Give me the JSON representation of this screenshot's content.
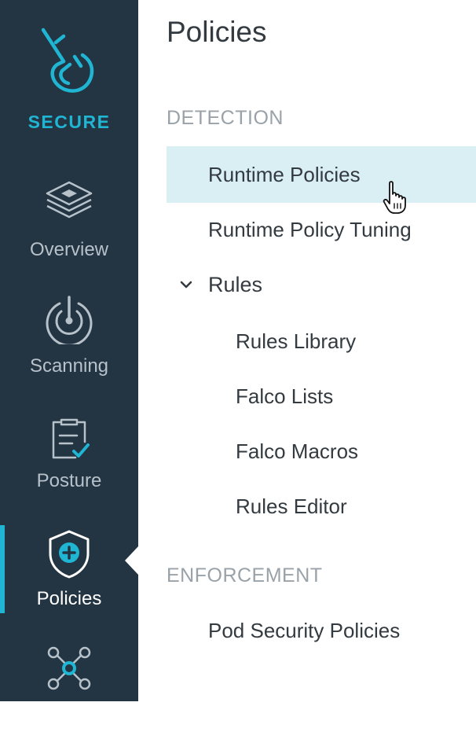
{
  "sidebar": {
    "brand": {
      "name": "SECURE",
      "icon": "secure-logo-icon",
      "color": "#1fb5d3"
    },
    "items": [
      {
        "label": "Overview",
        "icon": "layers-icon",
        "active": false
      },
      {
        "label": "Scanning",
        "icon": "scan-gauge-icon",
        "active": false
      },
      {
        "label": "Posture",
        "icon": "clipboard-check-icon",
        "active": false
      },
      {
        "label": "Policies",
        "icon": "shield-plus-icon",
        "active": true
      },
      {
        "label": "",
        "icon": "network-nodes-icon",
        "active": false
      }
    ]
  },
  "panel": {
    "title": "Policies",
    "sections": [
      {
        "label": "DETECTION",
        "items": [
          {
            "label": "Runtime Policies",
            "selected": true
          },
          {
            "label": "Runtime Policy Tuning",
            "selected": false
          },
          {
            "label": "Rules",
            "expanded": true,
            "children": [
              "Rules Library",
              "Falco Lists",
              "Falco Macros",
              "Rules Editor"
            ]
          }
        ]
      },
      {
        "label": "ENFORCEMENT",
        "items": [
          {
            "label": "Pod Security Policies",
            "selected": false
          }
        ]
      }
    ]
  },
  "colors": {
    "sidebar_bg": "#233442",
    "accent": "#1fb5d3",
    "selected_bg": "#d9eff4"
  }
}
